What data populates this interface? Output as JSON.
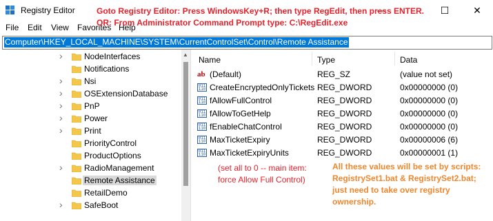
{
  "window": {
    "title": "Registry Editor",
    "controls": {
      "minimize": "—",
      "maximize": "☐",
      "close": "✕"
    }
  },
  "menu": [
    "File",
    "Edit",
    "View",
    "Favorites",
    "Help"
  ],
  "address": "Computer\\HKEY_LOCAL_MACHINE\\SYSTEM\\CurrentControlSet\\Control\\Remote Assistance",
  "tree": {
    "items": [
      {
        "label": "NodeInterfaces",
        "expandable": true
      },
      {
        "label": "Notifications",
        "expandable": false
      },
      {
        "label": "Nsi",
        "expandable": true
      },
      {
        "label": "OSExtensionDatabase",
        "expandable": true
      },
      {
        "label": "PnP",
        "expandable": true
      },
      {
        "label": "Power",
        "expandable": true
      },
      {
        "label": "Print",
        "expandable": true
      },
      {
        "label": "PriorityControl",
        "expandable": false
      },
      {
        "label": "ProductOptions",
        "expandable": false
      },
      {
        "label": "RadioManagement",
        "expandable": true
      },
      {
        "label": "Remote Assistance",
        "expandable": false,
        "selected": true
      },
      {
        "label": "RetailDemo",
        "expandable": false
      },
      {
        "label": "SafeBoot",
        "expandable": true
      }
    ]
  },
  "list": {
    "columns": [
      "Name",
      "Type",
      "Data"
    ],
    "rows": [
      {
        "icon": "string-value-icon",
        "name": "(Default)",
        "type": "REG_SZ",
        "data": "(value not set)"
      },
      {
        "icon": "dword-value-icon",
        "name": "CreateEncryptedOnlyTickets",
        "type": "REG_DWORD",
        "data": "0x00000000 (0)"
      },
      {
        "icon": "dword-value-icon",
        "name": "fAllowFullControl",
        "type": "REG_DWORD",
        "data": "0x00000000 (0)"
      },
      {
        "icon": "dword-value-icon",
        "name": "fAllowToGetHelp",
        "type": "REG_DWORD",
        "data": "0x00000000 (0)"
      },
      {
        "icon": "dword-value-icon",
        "name": "fEnableChatControl",
        "type": "REG_DWORD",
        "data": "0x00000000 (0)"
      },
      {
        "icon": "dword-value-icon",
        "name": "MaxTicketExpiry",
        "type": "REG_DWORD",
        "data": "0x00000006 (6)"
      },
      {
        "icon": "dword-value-icon",
        "name": "MaxTicketExpiryUnits",
        "type": "REG_DWORD",
        "data": "0x00000001 (1)"
      }
    ]
  },
  "annotations": {
    "top_line1": "Goto Registry Editor: Press WindowsKey+R; then type RegEdit, then press ENTER.",
    "top_line2": "OR: From Administrator Command Prompt type: C:\\RegEdit.exe",
    "red_note": "(set all to 0 -- main item: force Allow Full Control)",
    "orange_note": "All these values will be set by scripts: RegistrySet1.bat & RegistrySet2.bat; just need to take over registry ownership."
  },
  "colors": {
    "annotation_red": "#e8202a",
    "annotation_orange": "#f0862c",
    "address_highlight": "#0078d7"
  }
}
